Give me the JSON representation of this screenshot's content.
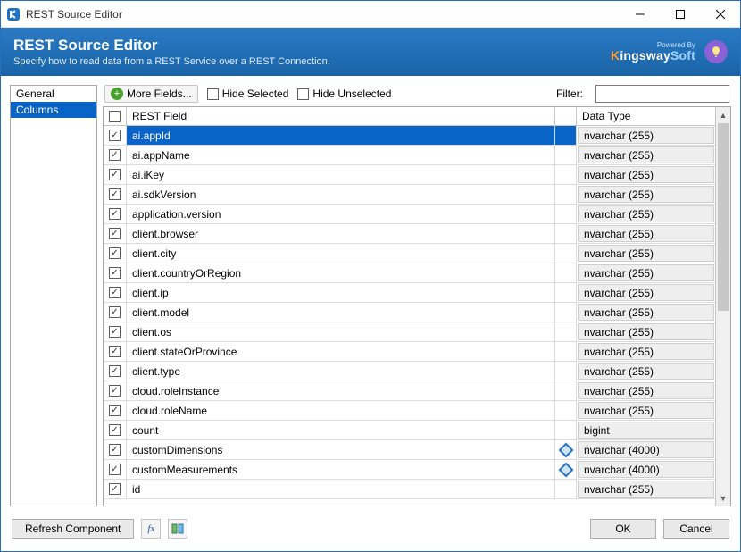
{
  "window": {
    "title": "REST Source Editor"
  },
  "header": {
    "title": "REST Source Editor",
    "subtitle": "Specify how to read data from a REST Service over a REST Connection.",
    "brand_powered": "Powered By",
    "brand_name": "KingswaySoft"
  },
  "sidebar": {
    "items": [
      "General",
      "Columns"
    ],
    "active_index": 1
  },
  "toolbar": {
    "more_fields": "More Fields...",
    "hide_selected": "Hide Selected",
    "hide_unselected": "Hide Unselected",
    "filter_label": "Filter:",
    "filter_value": ""
  },
  "grid": {
    "header_field": "REST Field",
    "header_type": "Data Type",
    "rows": [
      {
        "field": "ai.appId",
        "type": "nvarchar (255)",
        "selected": true
      },
      {
        "field": "ai.appName",
        "type": "nvarchar (255)"
      },
      {
        "field": "ai.iKey",
        "type": "nvarchar (255)"
      },
      {
        "field": "ai.sdkVersion",
        "type": "nvarchar (255)"
      },
      {
        "field": "application.version",
        "type": "nvarchar (255)"
      },
      {
        "field": "client.browser",
        "type": "nvarchar (255)"
      },
      {
        "field": "client.city",
        "type": "nvarchar (255)"
      },
      {
        "field": "client.countryOrRegion",
        "type": "nvarchar (255)"
      },
      {
        "field": "client.ip",
        "type": "nvarchar (255)"
      },
      {
        "field": "client.model",
        "type": "nvarchar (255)"
      },
      {
        "field": "client.os",
        "type": "nvarchar (255)"
      },
      {
        "field": "client.stateOrProvince",
        "type": "nvarchar (255)"
      },
      {
        "field": "client.type",
        "type": "nvarchar (255)"
      },
      {
        "field": "cloud.roleInstance",
        "type": "nvarchar (255)"
      },
      {
        "field": "cloud.roleName",
        "type": "nvarchar (255)"
      },
      {
        "field": "count",
        "type": "bigint"
      },
      {
        "field": "customDimensions",
        "type": "nvarchar (4000)",
        "icon": "diamond"
      },
      {
        "field": "customMeasurements",
        "type": "nvarchar (4000)",
        "icon": "diamond"
      },
      {
        "field": "id",
        "type": "nvarchar (255)"
      }
    ]
  },
  "footer": {
    "refresh": "Refresh Component",
    "ok": "OK",
    "cancel": "Cancel"
  }
}
